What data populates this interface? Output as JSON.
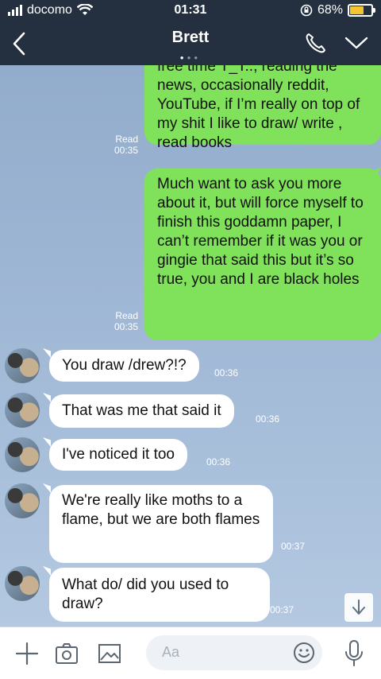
{
  "status_bar": {
    "carrier": "docomo",
    "time": "01:31",
    "battery": "68%"
  },
  "header": {
    "title": "Brett"
  },
  "messages": [
    {
      "text": "free time T_T.., reading the news, occasionally reddit, YouTube, if I’m really on top of my shit I like to draw/ write , read books",
      "status": "Read",
      "time": "00:35"
    },
    {
      "text": "Much want to ask you more about it, but will force myself to finish this goddamn paper, I can’t remember if it was you or gingie that said this but it’s so true, you and I are black holes",
      "status": "Read",
      "time": "00:35"
    },
    {
      "text": "You draw /drew?!?",
      "time": "00:36"
    },
    {
      "text": "That was me that said it",
      "time": "00:36"
    },
    {
      "text": "I've noticed it too",
      "time": "00:36"
    },
    {
      "text": "We're really like moths to a flame, but we are both flames",
      "time": "00:37"
    },
    {
      "text": "What do/ did you used to draw?",
      "time": "00:37"
    }
  ],
  "input": {
    "placeholder": "Aa"
  },
  "icons": [
    "back-icon",
    "phone-icon",
    "chevron-down-icon",
    "plus-icon",
    "camera-icon",
    "image-icon",
    "emoji-icon",
    "microphone-icon",
    "arrow-down-icon"
  ],
  "colors": {
    "header": "#24303f",
    "outgoing_bubble": "#80e15a",
    "incoming_bubble": "#ffffff",
    "battery": "#f4c531"
  }
}
